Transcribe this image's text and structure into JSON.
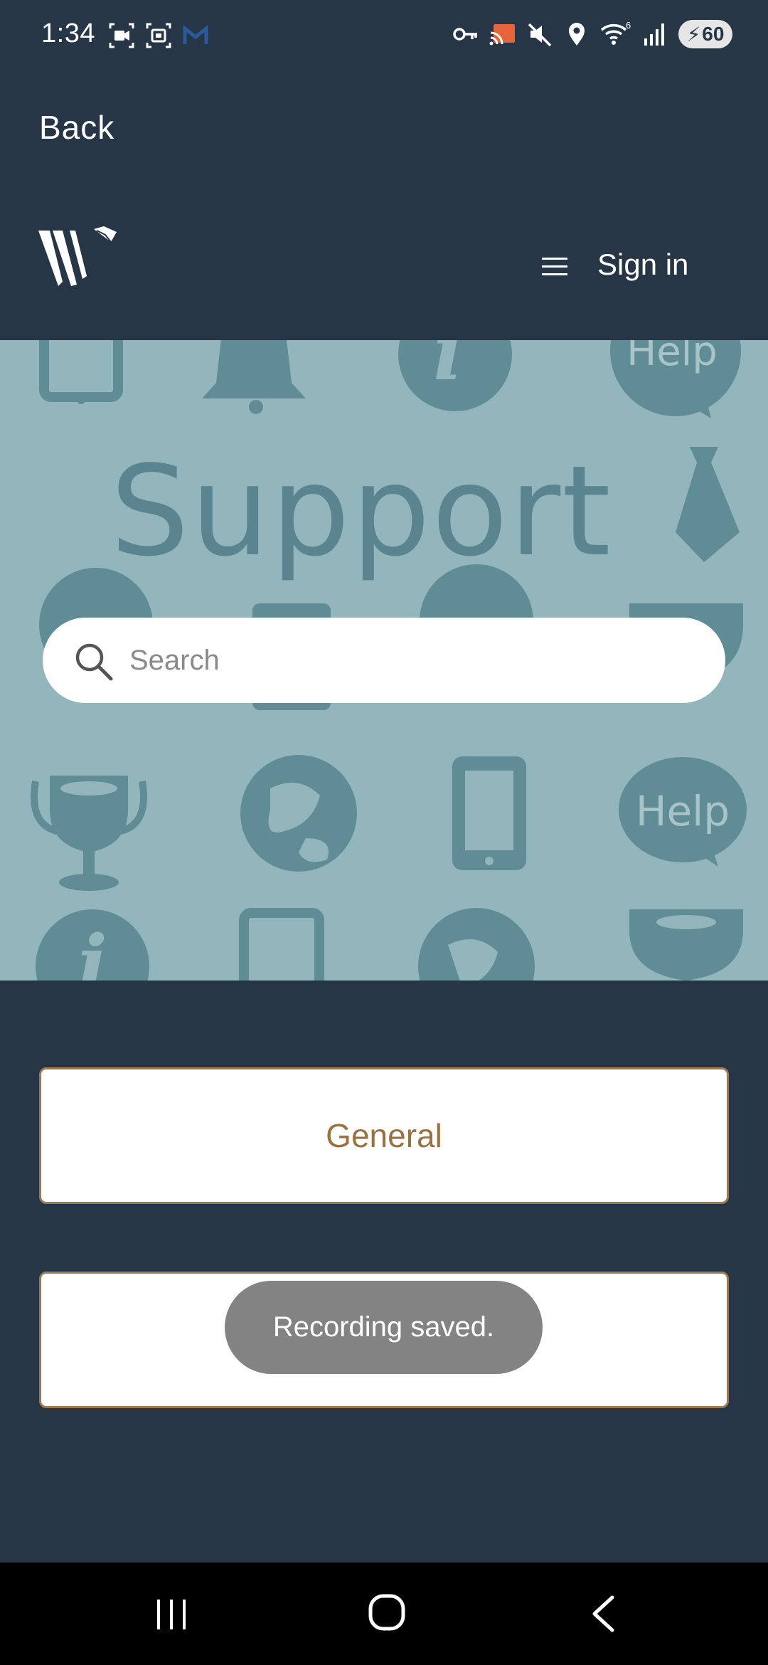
{
  "status_bar": {
    "time": "1:34",
    "battery_level": "60",
    "wifi_badge": "6",
    "left_icons": [
      "screen-record-icon",
      "screenshot-icon",
      "gmail-icon"
    ],
    "right_icons": [
      "vpn-key-icon",
      "cast-icon",
      "mute-icon",
      "location-icon",
      "wifi-icon",
      "signal-icon",
      "battery-icon"
    ]
  },
  "header": {
    "back_label": "Back",
    "sign_in_label": "Sign in",
    "logo": "W-logo-icon"
  },
  "hero": {
    "title": "Support",
    "search_placeholder": "Search"
  },
  "categories": [
    {
      "label": "General"
    },
    {
      "label": ""
    }
  ],
  "toast": {
    "message": "Recording saved."
  },
  "colors": {
    "app_background": "#263646",
    "hero_background": "#93b6bd",
    "hero_pattern": "#5a8590",
    "card_border": "#9a7a52",
    "card_text": "#9a7242",
    "toast_background": "#787878"
  }
}
